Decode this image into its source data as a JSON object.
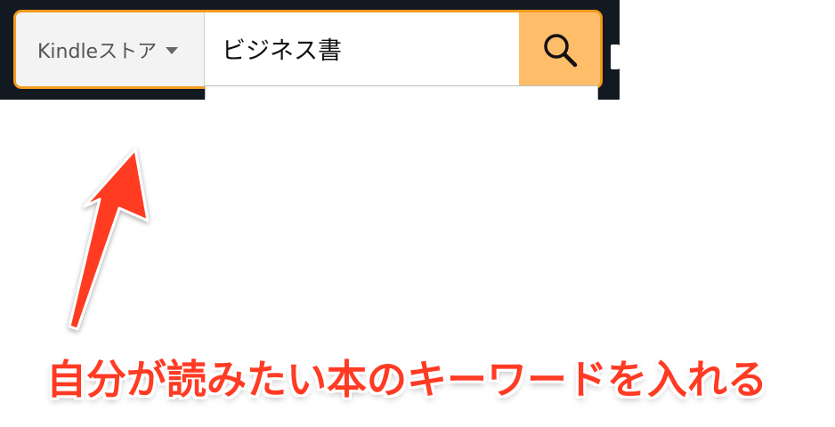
{
  "search": {
    "category_label": "Kindleストア",
    "query_value": "ビジネス書",
    "accent_color": "#f39a1e",
    "button_color": "#febd69",
    "button_icon": "search-icon"
  },
  "header": {
    "background_color": "#131921"
  },
  "annotation": {
    "text": "自分が読みたい本のキーワードを入れる",
    "color": "#ff3b24",
    "arrow_icon": "arrow-up-icon"
  }
}
